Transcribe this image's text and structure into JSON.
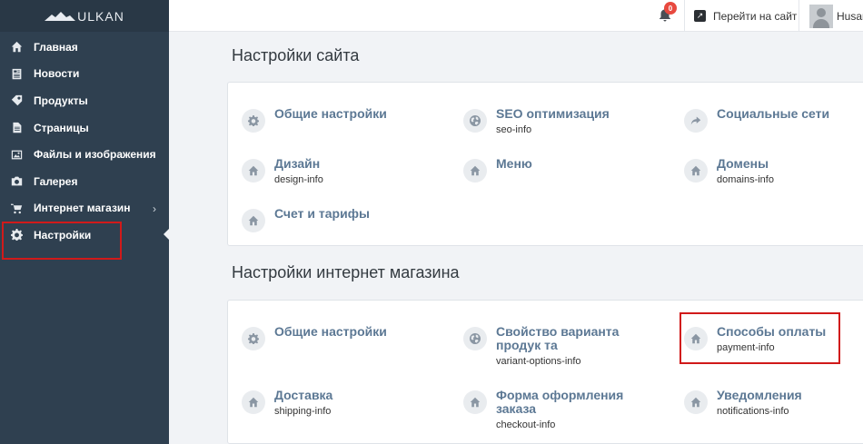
{
  "brand": {
    "name": "ULKAN"
  },
  "sidebar": {
    "items": [
      {
        "label": "Главная",
        "icon": "home-icon"
      },
      {
        "label": "Новости",
        "icon": "news-icon"
      },
      {
        "label": "Продукты",
        "icon": "products-icon"
      },
      {
        "label": "Страницы",
        "icon": "page-icon"
      },
      {
        "label": "Файлы и изображения",
        "icon": "image-icon"
      },
      {
        "label": "Галерея",
        "icon": "camera-icon"
      },
      {
        "label": "Интернет магазин",
        "icon": "cart-icon",
        "chevron": "›"
      },
      {
        "label": "Настройки",
        "icon": "gear-icon",
        "active": true
      }
    ]
  },
  "topbar": {
    "notifications_count": "0",
    "goto_site_label": "Перейти на сайт",
    "user_name": "Husan"
  },
  "site_settings": {
    "title": "Настройки сайта",
    "tiles": [
      {
        "title": "Общие настройки",
        "sub": ""
      },
      {
        "title": "SEO оптимизация",
        "sub": "seo-info"
      },
      {
        "title": "Социальные сети",
        "sub": ""
      },
      {
        "title": "Дизайн",
        "sub": "design-info"
      },
      {
        "title": "Меню",
        "sub": ""
      },
      {
        "title": "Домены",
        "sub": "domains-info"
      },
      {
        "title": "Счет и тарифы",
        "sub": ""
      }
    ]
  },
  "shop_settings": {
    "title": "Настройки интернет магазина",
    "tiles": [
      {
        "title": "Общие настройки",
        "sub": ""
      },
      {
        "title": "Свойство варианта продук та",
        "sub": "variant-options-info"
      },
      {
        "title": "Способы оплаты",
        "sub": "payment-info"
      },
      {
        "title": "Доставка",
        "sub": "shipping-info"
      },
      {
        "title": "Форма оформления заказа",
        "sub": "checkout-info"
      },
      {
        "title": "Уведомления",
        "sub": "notifications-info"
      }
    ]
  },
  "colors": {
    "sidebar": "#2f4050",
    "link": "#5c7894",
    "highlight": "#d11a1a",
    "badge": "#e8493f"
  }
}
